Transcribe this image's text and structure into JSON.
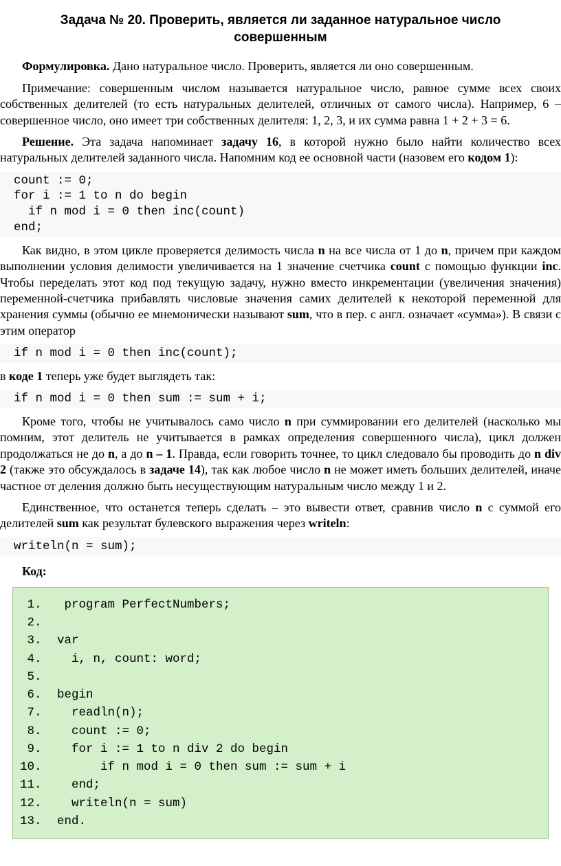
{
  "title": "Задача № 20. Проверить, является ли заданное натуральное число совершенным",
  "p1_pre": "Формулировка.",
  "p1_rest": " Дано натуральное число. Проверить, является ли оно совершенным.",
  "p2": "Примечание: совершенным числом называется натуральное число, равное сумме всех своих собственных делителей (то есть натуральных делителей, отличных от самого числа). Например, 6 – совершенное число, оно имеет три собственных делителя: 1, 2, 3, и их сумма равна 1 + 2 + 3 = 6.",
  "p3_pre": "Решение.",
  "p3_a": " Эта задача напоминает ",
  "p3_b": "задачу 16",
  "p3_c": ", в которой нужно было найти количество всех натуральных делителей заданного числа. Напомним код ее основной части (назовем его ",
  "p3_d": "кодом 1",
  "p3_e": "):",
  "code1": "count := 0;\nfor i := 1 to n do begin\n  if n mod i = 0 then inc(count)\nend;",
  "p4_a": "Как видно, в этом цикле проверяется делимость числа ",
  "p4_b": "n",
  "p4_c": " на все числа от 1 до ",
  "p4_d": "n",
  "p4_e": ", причем при каждом выполнении условия делимости увеличивается на 1 значение счетчика ",
  "p4_f": "count",
  "p4_g": " с помощью функции ",
  "p4_h": "inc",
  "p4_i": ". Чтобы переделать этот код под текущую задачу, нужно вместо инкрементации (увеличения значения) переменной-счетчика прибавлять числовые значения самих делителей к некоторой переменной для хранения суммы (обычно ее мнемонически называют ",
  "p4_j": "sum",
  "p4_k": ", что в пер. с англ. означает «сумма»). В связи с этим оператор",
  "code2": "if n mod i = 0 then inc(count);",
  "p5_a": "в ",
  "p5_b": "коде 1",
  "p5_c": " теперь уже будет выглядеть так:",
  "code3": "if n mod i = 0 then sum := sum + i;",
  "p6_a": "Кроме того, чтобы не учитывалось само число ",
  "p6_b": "n",
  "p6_c": " при суммировании его делителей (насколько мы помним, этот делитель не учитывается в рамках определения совершенного числа), цикл должен продолжаться не до ",
  "p6_d": "n",
  "p6_e": ", а до ",
  "p6_f": "n – 1",
  "p6_g": ". Правда, если говорить точнее, то цикл следовало бы проводить до ",
  "p6_h": "n div 2",
  "p6_i": " (также это обсуждалось в ",
  "p6_j": "задаче 14",
  "p6_k": "), так как любое число ",
  "p6_l": "n",
  "p6_m": " не может иметь больших делителей, иначе частное от деления должно быть несуществующим натуральным число между 1 и 2.",
  "p7_a": "Единственное, что останется теперь сделать – это вывести ответ, сравнив число ",
  "p7_b": "n",
  "p7_c": " с суммой его делителей ",
  "p7_d": "sum",
  "p7_e": " как результат булевского выражения через ",
  "p7_f": "writeln",
  "p7_g": ":",
  "code4": "writeln(n = sum);",
  "code_label": "Код:",
  "final_code": [
    " program PerfectNumbers;",
    "",
    "var",
    "  i, n, count: word;",
    "",
    "begin",
    "  readln(n);",
    "  count := 0;",
    "  for i := 1 to n div 2 do begin",
    "      if n mod i = 0 then sum := sum + i",
    "  end;",
    "  writeln(n = sum)",
    "end."
  ]
}
